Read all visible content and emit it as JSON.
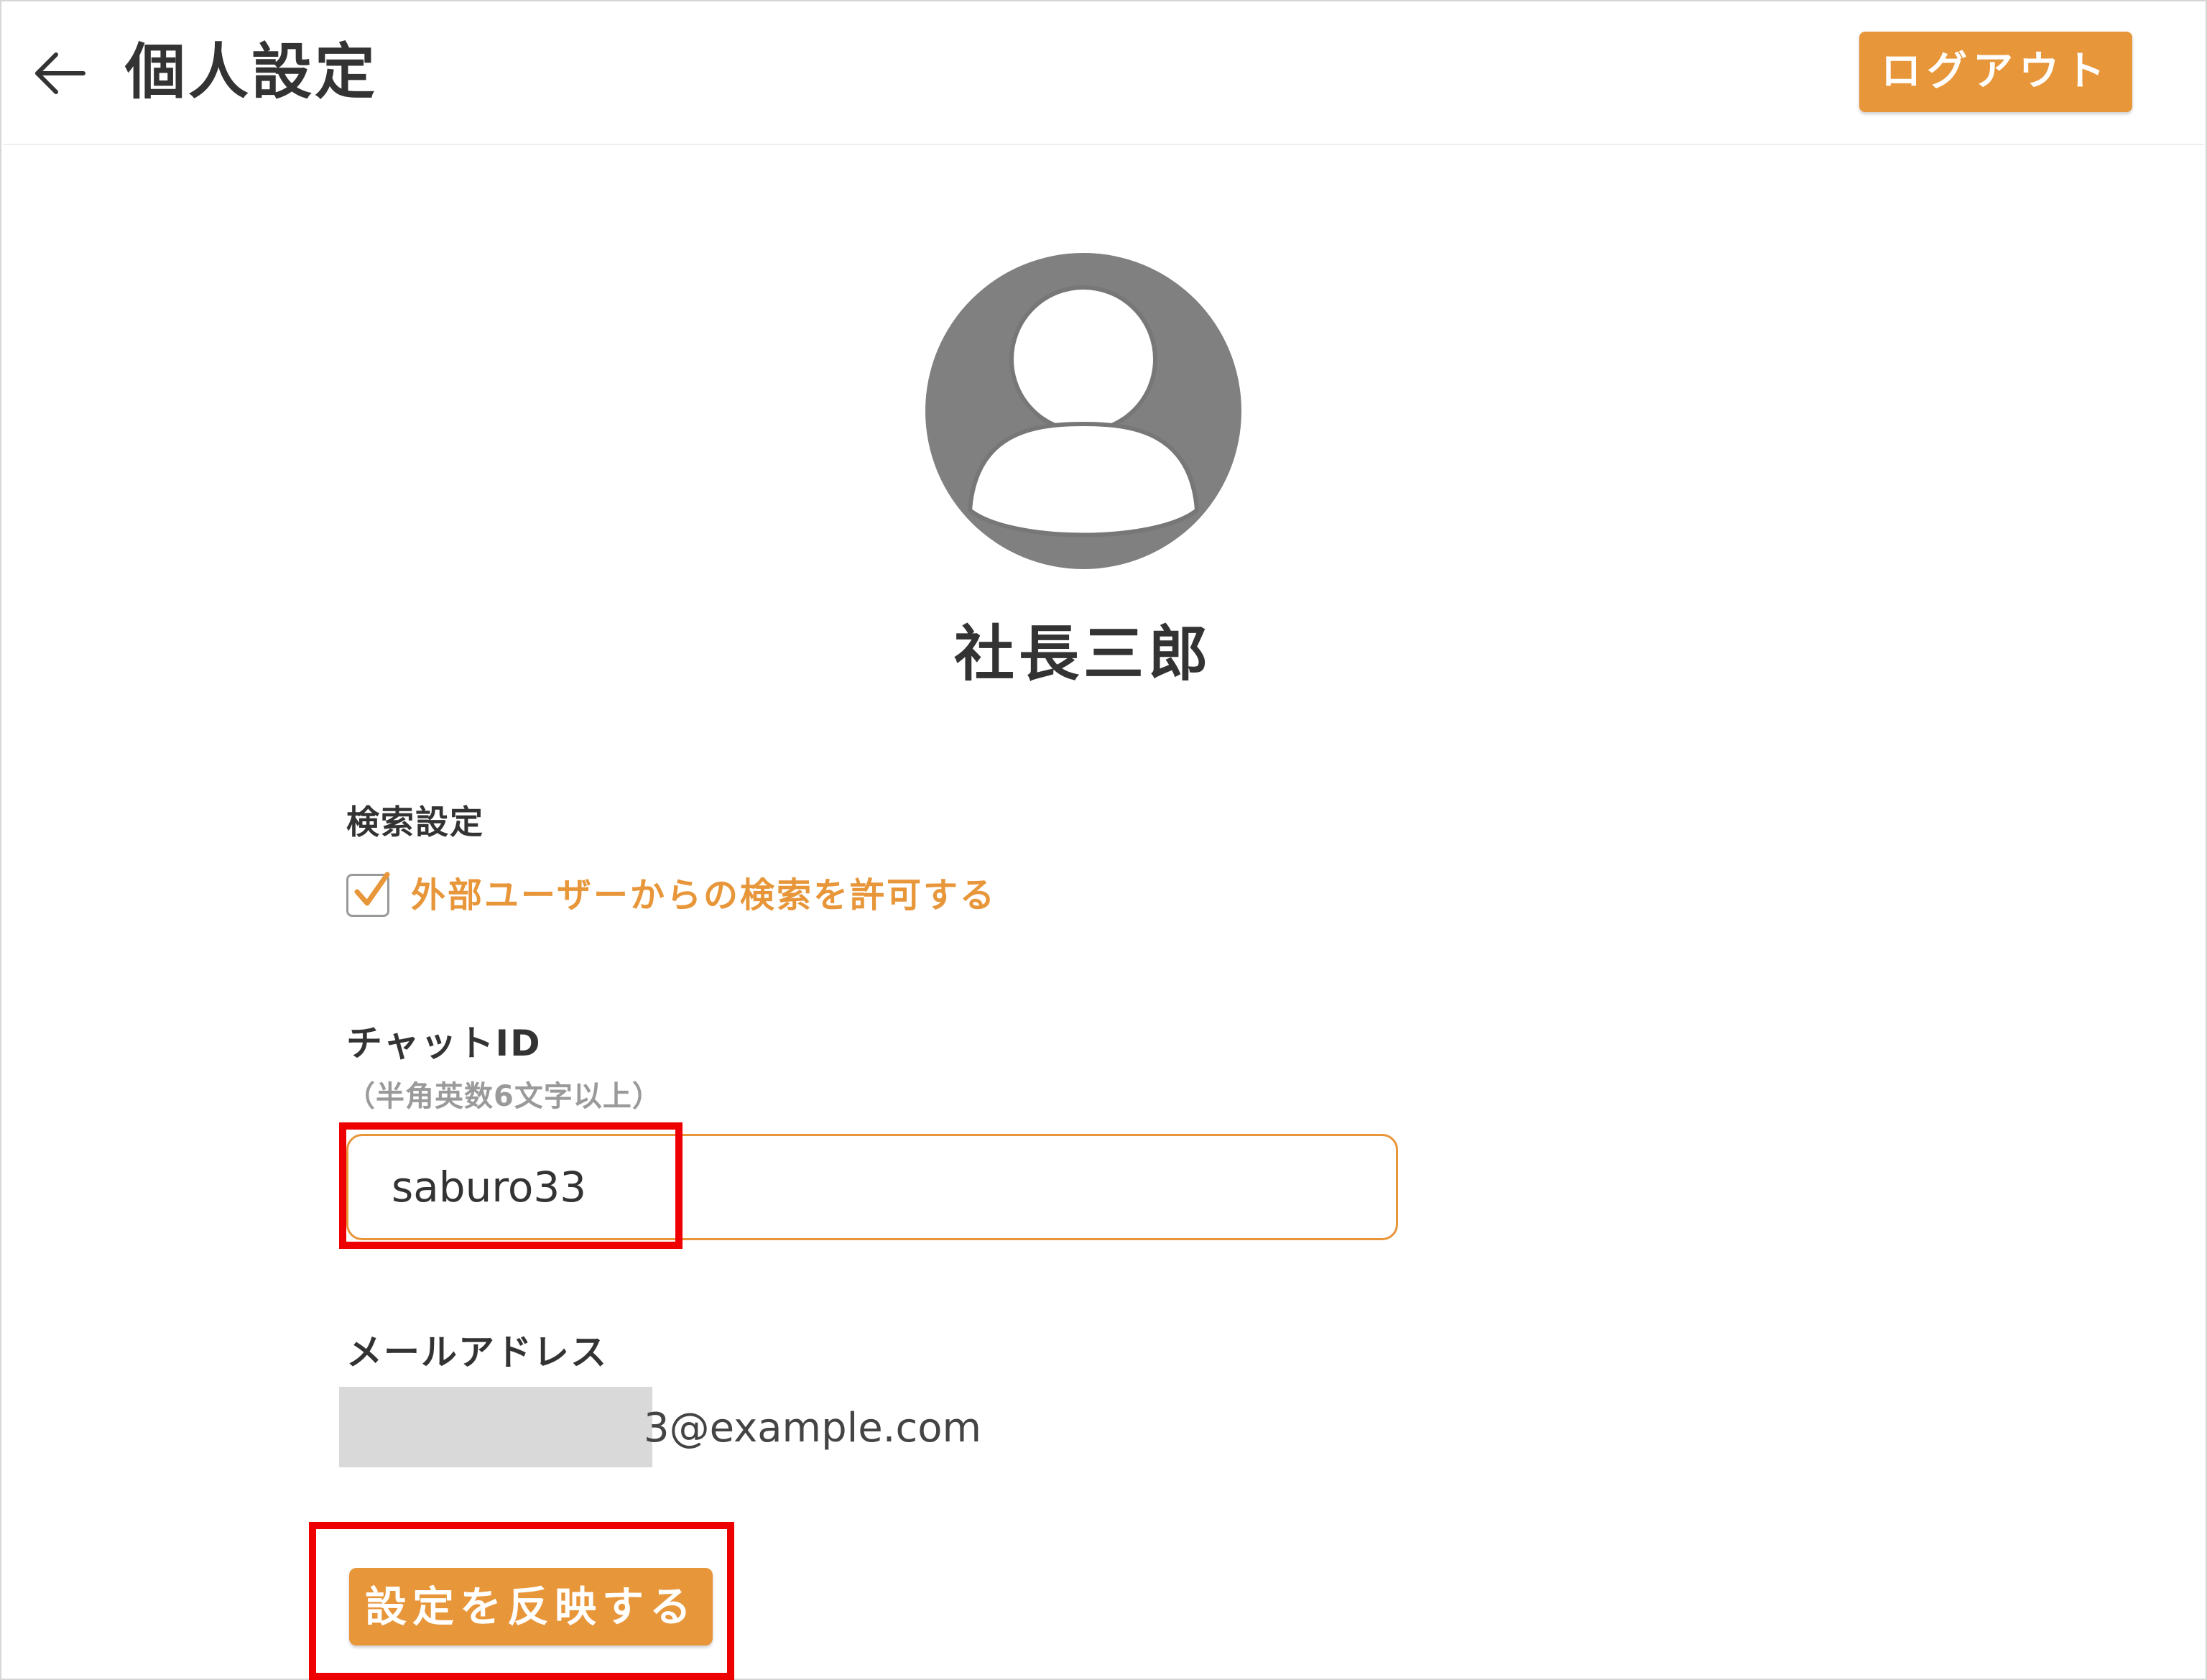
{
  "header": {
    "title": "個人設定",
    "logout_label": "ログアウト"
  },
  "profile": {
    "name": "社長三郎"
  },
  "search_settings": {
    "label": "検索設定",
    "allow_external_label": "外部ユーザーからの検索を許可する",
    "checked": true
  },
  "chat_id": {
    "label": "チャットID",
    "hint": "（半角英数6文字以上）",
    "value": "saburo33"
  },
  "email": {
    "label": "メールアドレス",
    "value_visible": "3@example.com"
  },
  "apply_label": "設定を反映する",
  "colors": {
    "accent": "#e8963a",
    "highlight": "#ee0000",
    "avatar_bg": "#808080"
  },
  "icons": {
    "back": "arrow-left-icon",
    "avatar": "user-silhouette-icon",
    "checkbox": "check-icon"
  }
}
